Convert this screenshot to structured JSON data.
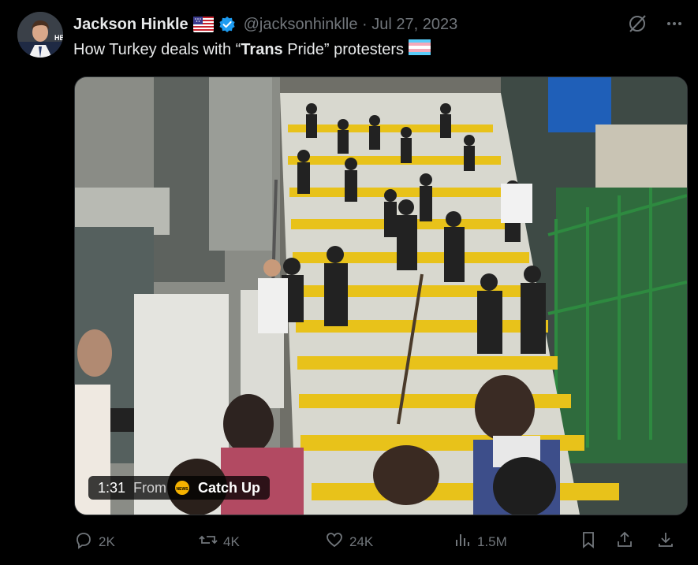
{
  "tweet": {
    "author_name": "Jackson Hinkle",
    "handle_date": "@jacksonhinklle · Jul 27, 2023",
    "text_part1": "How Turkey deals with “",
    "text_bold": "Trans",
    "text_part2": " Pride” protesters"
  },
  "video": {
    "duration": "1:31",
    "from_label": "From",
    "source": "Catch Up"
  },
  "actions": {
    "replies": "2K",
    "reposts": "4K",
    "likes": "24K",
    "views": "1.5M"
  },
  "colors": {
    "background": "#000000",
    "text": "#e7e9ea",
    "muted": "#71767b",
    "verified": "#1d9bf0",
    "stair_yellow": "#e8c21a"
  },
  "icons": [
    "verified-badge-icon",
    "us-flag-icon",
    "grok-slash-icon",
    "more-icon",
    "trans-flag-icon",
    "reply-icon",
    "repost-icon",
    "like-icon",
    "views-icon",
    "bookmark-icon",
    "share-icon",
    "download-icon"
  ]
}
